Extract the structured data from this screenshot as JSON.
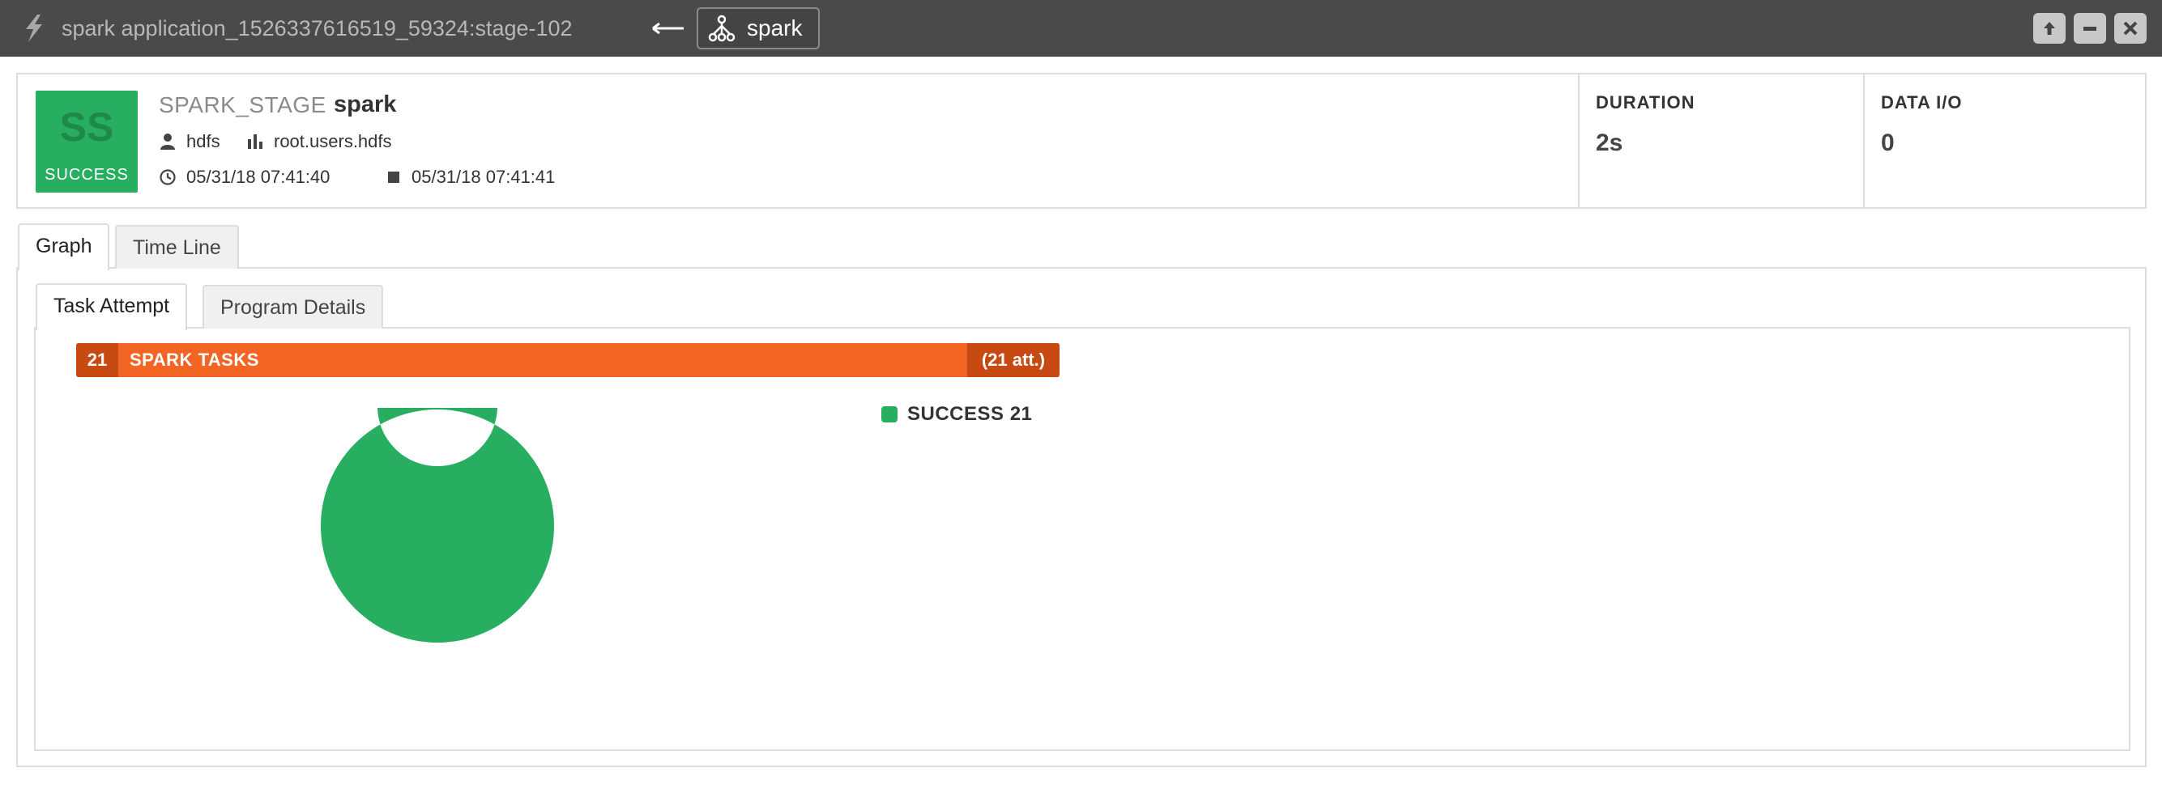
{
  "titlebar": {
    "title": "spark application_1526337616519_59324:stage-102",
    "chip_label": "spark",
    "icons": [
      "lightning-icon",
      "back-arrow-icon",
      "hierarchy-icon",
      "maximize-icon",
      "minimize-icon",
      "close-icon"
    ]
  },
  "header": {
    "badge_abbr": "SS",
    "badge_status": "SUCCESS",
    "type": "SPARK_STAGE",
    "name": "spark",
    "user": "hdfs",
    "queue": "root.users.hdfs",
    "start_time": "05/31/18 07:41:40",
    "end_time": "05/31/18 07:41:41",
    "duration_label": "DURATION",
    "duration_value": "2s",
    "dataio_label": "DATA I/O",
    "dataio_value": "0"
  },
  "tabs": {
    "outer": [
      "Graph",
      "Time Line"
    ],
    "inner": [
      "Task Attempt",
      "Program Details"
    ]
  },
  "tasks": {
    "count": "21",
    "label": "SPARK TASKS",
    "attempts": "(21 att.)"
  },
  "chart_data": {
    "type": "pie",
    "categories": [
      "SUCCESS"
    ],
    "values": [
      21
    ],
    "legend": [
      "SUCCESS 21"
    ],
    "colors": [
      "#27ae60"
    ]
  },
  "colors": {
    "success": "#27ae60",
    "task_bar": "#f26522",
    "task_bar_dark": "#c64a12",
    "titlebar": "#4a4a4a"
  }
}
